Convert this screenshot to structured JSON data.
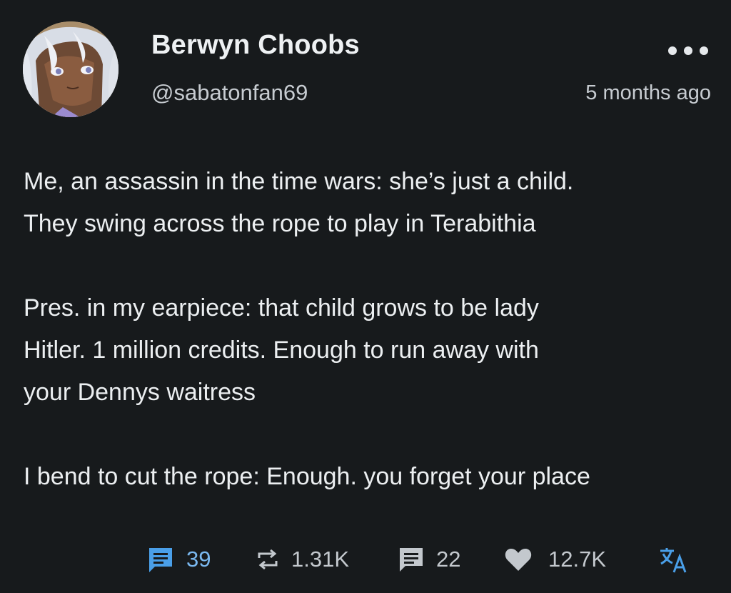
{
  "author": {
    "display_name": "Berwyn Choobs",
    "handle": "@sabatonfan69",
    "avatar_icon": "anime-avatar"
  },
  "post": {
    "timestamp": "5 months ago",
    "paragraphs": [
      [
        "Me, an assassin in the time wars: she’s just a child.",
        "They swing across the rope to play in Terabithia"
      ],
      [
        "Pres. in my earpiece: that child grows to be lady",
        "Hitler. 1 million credits. Enough to run away with",
        "your Dennys waitress"
      ],
      [
        "I bend to cut the rope: Enough. you forget your place"
      ]
    ]
  },
  "actions": {
    "comments": {
      "count": "39",
      "icon": "comment-icon",
      "color": "#4a9fe8"
    },
    "reposts": {
      "count": "1.31K",
      "icon": "repost-icon"
    },
    "quotes": {
      "count": "22",
      "icon": "quote-icon"
    },
    "likes": {
      "count": "12.7K",
      "icon": "heart-icon"
    },
    "translate": {
      "icon": "translate-icon",
      "color": "#4a9fe8"
    }
  }
}
